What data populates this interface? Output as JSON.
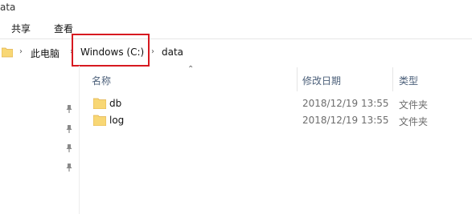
{
  "window": {
    "title": "ata"
  },
  "ribbon": {
    "tabs": [
      {
        "label": "共享"
      },
      {
        "label": "查看"
      }
    ]
  },
  "address_bar": {
    "crumbs": [
      {
        "label": "此电脑"
      },
      {
        "label": "Windows (C:)"
      },
      {
        "label": "data"
      }
    ]
  },
  "columns": {
    "name": "名称",
    "modified": "修改日期",
    "type": "类型"
  },
  "files": [
    {
      "name": "db",
      "modified": "2018/12/19 13:55",
      "type": "文件夹"
    },
    {
      "name": "log",
      "modified": "2018/12/19 13:55",
      "type": "文件夹"
    }
  ],
  "colors": {
    "folder": "#f8d775",
    "folder_dark": "#e8b94a",
    "highlight": "#d71920"
  },
  "icons": {
    "folder": "folder-icon",
    "pin": "pin-icon",
    "chevron": "chevron-right-icon",
    "sort": "sort-up-icon"
  }
}
